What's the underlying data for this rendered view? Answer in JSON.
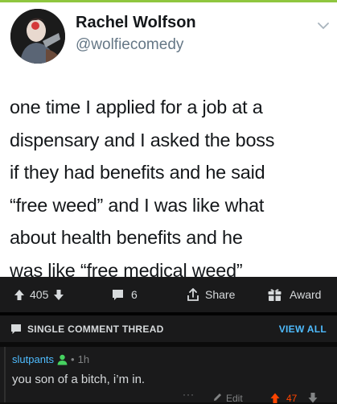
{
  "tweet": {
    "author_name": "Rachel Wolfson",
    "author_handle": "@wolfiecomedy",
    "text_lines": [
      "one time I applied for a job at a",
      "dispensary and I asked the boss",
      "if they had benefits and he said",
      "“free weed” and I was like what",
      "about health benefits and he",
      "was like “free medical weed”"
    ]
  },
  "post_actions": {
    "upvotes": "405",
    "comments": "6",
    "share_label": "Share",
    "award_label": "Award"
  },
  "thread": {
    "title": "SINGLE COMMENT THREAD",
    "view_all_label": "VIEW ALL"
  },
  "comment": {
    "author": "slutpants",
    "separator": "•",
    "age": "1h",
    "body": "you son of a bitch, i’m in.",
    "more_label": "···",
    "edit_label": "Edit",
    "score": "47"
  },
  "colors": {
    "reddit_bg": "#1a1a1b",
    "link_blue": "#4fbcff",
    "upvote_orange": "#ff4500",
    "tweet_text": "#14171a",
    "tweet_handle": "#657786",
    "op_badge_green": "#46d160"
  }
}
